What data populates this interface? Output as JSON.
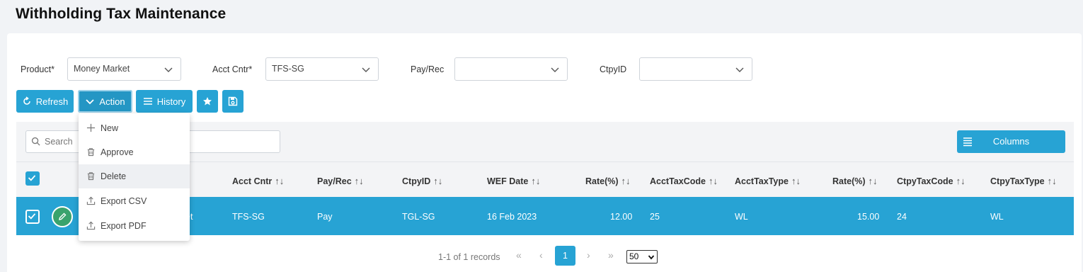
{
  "page": {
    "title": "Withholding Tax Maintenance"
  },
  "filters": {
    "product": {
      "label": "Product*",
      "value": "Money Market"
    },
    "acct_cntr": {
      "label": "Acct Cntr*",
      "value": "TFS-SG"
    },
    "pay_rec": {
      "label": "Pay/Rec",
      "value": ""
    },
    "ctpy_id": {
      "label": "CtpyID",
      "value": ""
    }
  },
  "toolbar": {
    "refresh_label": "Refresh",
    "action_label": "Action",
    "history_label": "History"
  },
  "action_menu": {
    "items": [
      {
        "label": "New",
        "icon": "plus-icon"
      },
      {
        "label": "Approve",
        "icon": "trash-icon"
      },
      {
        "label": "Delete",
        "icon": "trash-icon"
      },
      {
        "label": "Export CSV",
        "icon": "upload-icon"
      },
      {
        "label": "Export PDF",
        "icon": "upload-icon"
      }
    ],
    "hovered_index": 2
  },
  "grid": {
    "search_placeholder": "Search",
    "columns_label": "Columns",
    "sort_glyph": "↑↓",
    "headers": [
      "Acct Cntr",
      "Pay/Rec",
      "CtpyID",
      "WEF Date",
      "Rate(%)",
      "AcctTaxCode",
      "AcctTaxType",
      "Rate(%)",
      "CtpyTaxCode",
      "CtpyTaxType"
    ],
    "rows": [
      {
        "product_fragment": "et",
        "cells": [
          "TFS-SG",
          "Pay",
          "TGL-SG",
          "16 Feb 2023",
          "12.00",
          "25",
          "WL",
          "15.00",
          "24",
          "WL"
        ]
      }
    ]
  },
  "pagination": {
    "summary": "1-1 of 1 records",
    "current_page": "1",
    "page_size": "50"
  },
  "colors": {
    "accent": "#27a3d4",
    "edit_button": "#3aa36d",
    "header_band": "#f3f4f6"
  }
}
